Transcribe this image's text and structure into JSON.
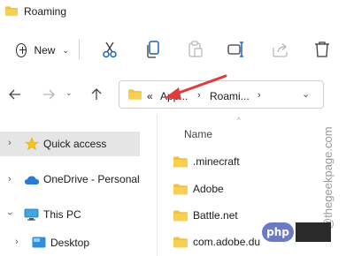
{
  "window": {
    "title": "Roaming"
  },
  "toolbar": {
    "new_label": "New",
    "icons": [
      "cut-icon",
      "copy-icon",
      "paste-icon",
      "rename-icon",
      "share-icon",
      "delete-icon"
    ]
  },
  "address": {
    "overflow": "«",
    "segments": [
      "App...",
      "Roami..."
    ],
    "separator": "›",
    "dropdown": "⌄"
  },
  "nav": {
    "items": [
      {
        "label": "Quick access",
        "icon": "star-icon",
        "selected": true
      },
      {
        "label": "OneDrive - Personal",
        "icon": "cloud-icon",
        "selected": false
      },
      {
        "label": "This PC",
        "icon": "monitor-icon",
        "selected": false
      },
      {
        "label": "Desktop",
        "icon": "desktop-icon",
        "selected": false
      }
    ]
  },
  "content": {
    "column_name": "Name",
    "files": [
      ".minecraft",
      "Adobe",
      "Battle.net",
      "com.adobe.du"
    ]
  },
  "watermark": {
    "text": "@thegeekpage.com",
    "badge": "php"
  },
  "colors": {
    "folder": "#f3c13a",
    "folder_dark": "#e0a31e",
    "accent": "#0067c0",
    "arrow": "#e23b3b",
    "selection": "#e5e5e5"
  }
}
